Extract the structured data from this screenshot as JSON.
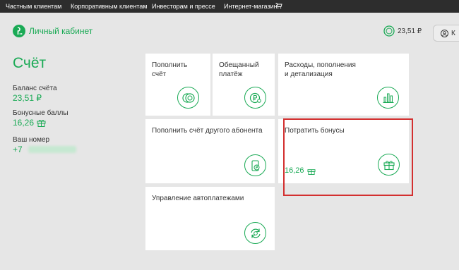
{
  "topnav": {
    "items": [
      "Частным клиентам",
      "Корпоративным клиентам",
      "Инвесторам и прессе",
      "Интернет-магазин"
    ],
    "cart_icon": "cart-icon"
  },
  "header": {
    "logo_text": "Личный кабинет",
    "balance": "23,51 ₽",
    "login_label": "К"
  },
  "account": {
    "title": "Счёт",
    "balance_label": "Баланс счёта",
    "balance_value": "23,51 ₽",
    "bonus_label": "Бонусные баллы",
    "bonus_value": "16,26",
    "phone_label": "Ваш номер",
    "phone_prefix": "+7"
  },
  "cards": {
    "topup": "Пополнить\nсчёт",
    "promised": "Обещанный\nплатёж",
    "expenses": "Расходы, пополнения\nи детализация",
    "topup_other": "Пополнить счёт другого абонента",
    "spend_bonus": "Потратить бонусы",
    "spend_bonus_value": "16,26",
    "autopay": "Управление автоплатежами"
  },
  "colors": {
    "accent": "#1aaa55",
    "topbar": "#2d2d2d",
    "page_bg": "#e6e6e6",
    "highlight": "#d32f2f"
  }
}
